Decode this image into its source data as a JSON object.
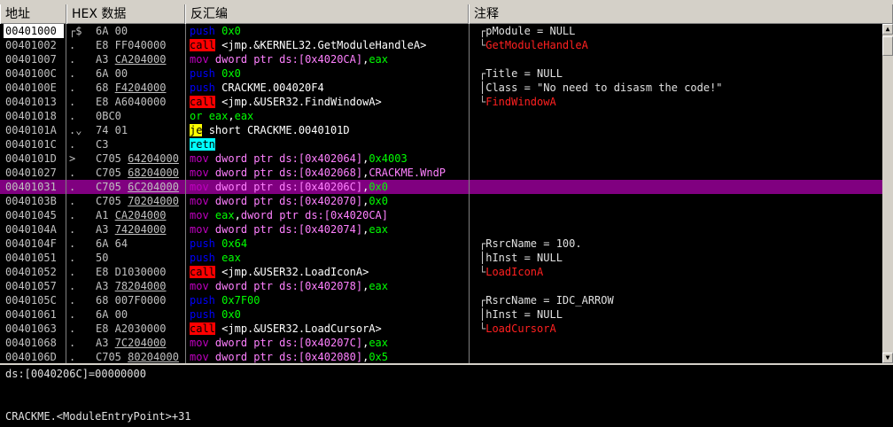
{
  "headers": {
    "address": "地址",
    "hex": "HEX 数据",
    "disasm": "反汇编",
    "comment": "注释"
  },
  "rows": [
    {
      "addr": "00401000",
      "mark": "┌$",
      "hex": "6A 00",
      "mn": "push",
      "ops": "0x0",
      "comment": "┌pModule = NULL"
    },
    {
      "addr": "00401002",
      "mark": ".",
      "hex": "E8 FF040000",
      "mn": "call",
      "ops": "<jmp.&KERNEL32.GetModuleHandleA>",
      "comment": "└GetModuleHandleA"
    },
    {
      "addr": "00401007",
      "mark": ".",
      "hex": "A3 CA204000",
      "mn": "mov",
      "ops": "dword ptr ds:[0x4020CA],eax",
      "comment": ""
    },
    {
      "addr": "0040100C",
      "mark": ".",
      "hex": "6A 00",
      "mn": "push",
      "ops": "0x0",
      "comment": "┌Title = NULL"
    },
    {
      "addr": "0040100E",
      "mark": ".",
      "hex": "68 F4204000",
      "mn": "push",
      "ops": "CRACKME.004020F4",
      "comment": "│Class = \"No need to disasm the code!\""
    },
    {
      "addr": "00401013",
      "mark": ".",
      "hex": "E8 A6040000",
      "mn": "call",
      "ops": "<jmp.&USER32.FindWindowA>",
      "comment": "└FindWindowA"
    },
    {
      "addr": "00401018",
      "mark": ".",
      "hex": "0BC0",
      "mn": "or",
      "ops": "eax,eax",
      "comment": ""
    },
    {
      "addr": "0040101A",
      "mark": ".⌄",
      "hex": "74 01",
      "mn": "je",
      "ops": "short CRACKME.0040101D",
      "comment": ""
    },
    {
      "addr": "0040101C",
      "mark": ".",
      "hex": "C3",
      "mn": "retn",
      "ops": "",
      "comment": ""
    },
    {
      "addr": "0040101D",
      "mark": ">",
      "hex": "C705 64204000",
      "mn": "mov",
      "ops": "dword ptr ds:[0x402064],0x4003",
      "comment": ""
    },
    {
      "addr": "00401027",
      "mark": ".",
      "hex": "C705 68204000",
      "mn": "mov",
      "ops": "dword ptr ds:[0x402068],CRACKME.WndP",
      "comment": ""
    },
    {
      "addr": "00401031",
      "mark": ".",
      "hex": "C705 6C204000",
      "mn": "mov",
      "ops": "dword ptr ds:[0x40206C],0x0",
      "comment": ""
    },
    {
      "addr": "0040103B",
      "mark": ".",
      "hex": "C705 70204000",
      "mn": "mov",
      "ops": "dword ptr ds:[0x402070],0x0",
      "comment": ""
    },
    {
      "addr": "00401045",
      "mark": ".",
      "hex": "A1 CA204000",
      "mn": "mov",
      "ops": "eax,dword ptr ds:[0x4020CA]",
      "comment": ""
    },
    {
      "addr": "0040104A",
      "mark": ".",
      "hex": "A3 74204000",
      "mn": "mov",
      "ops": "dword ptr ds:[0x402074],eax",
      "comment": ""
    },
    {
      "addr": "0040104F",
      "mark": ".",
      "hex": "6A 64",
      "mn": "push",
      "ops": "0x64",
      "comment": "┌RsrcName = 100."
    },
    {
      "addr": "00401051",
      "mark": ".",
      "hex": "50",
      "mn": "push",
      "ops": "eax",
      "comment": "│hInst = NULL"
    },
    {
      "addr": "00401052",
      "mark": ".",
      "hex": "E8 D1030000",
      "mn": "call",
      "ops": "<jmp.&USER32.LoadIconA>",
      "comment": "└LoadIconA"
    },
    {
      "addr": "00401057",
      "mark": ".",
      "hex": "A3 78204000",
      "mn": "mov",
      "ops": "dword ptr ds:[0x402078],eax",
      "comment": ""
    },
    {
      "addr": "0040105C",
      "mark": ".",
      "hex": "68 007F0000",
      "mn": "push",
      "ops": "0x7F00",
      "comment": "┌RsrcName = IDC_ARROW"
    },
    {
      "addr": "00401061",
      "mark": ".",
      "hex": "6A 00",
      "mn": "push",
      "ops": "0x0",
      "comment": "│hInst = NULL"
    },
    {
      "addr": "00401063",
      "mark": ".",
      "hex": "E8 A2030000",
      "mn": "call",
      "ops": "<jmp.&USER32.LoadCursorA>",
      "comment": "└LoadCursorA"
    },
    {
      "addr": "00401068",
      "mark": ".",
      "hex": "A3 7C204000",
      "mn": "mov",
      "ops": "dword ptr ds:[0x40207C],eax",
      "comment": ""
    },
    {
      "addr": "0040106D",
      "mark": ".",
      "hex": "C705 80204000",
      "mn": "mov",
      "ops": "dword ptr ds:[0x402080],0x5",
      "comment": ""
    }
  ],
  "selected_row_index": 11,
  "info_line_1": "ds:[0040206C]=00000000",
  "info_line_2": "CRACKME.<ModuleEntryPoint>+31",
  "icons": {
    "scroll_up": "up-arrow-icon"
  },
  "colors": {
    "selection": "#800080",
    "call": "#ff0000",
    "push": "#0000ff",
    "mov": "#c000c0",
    "je": "#ffff00",
    "retn": "#00ffff"
  }
}
